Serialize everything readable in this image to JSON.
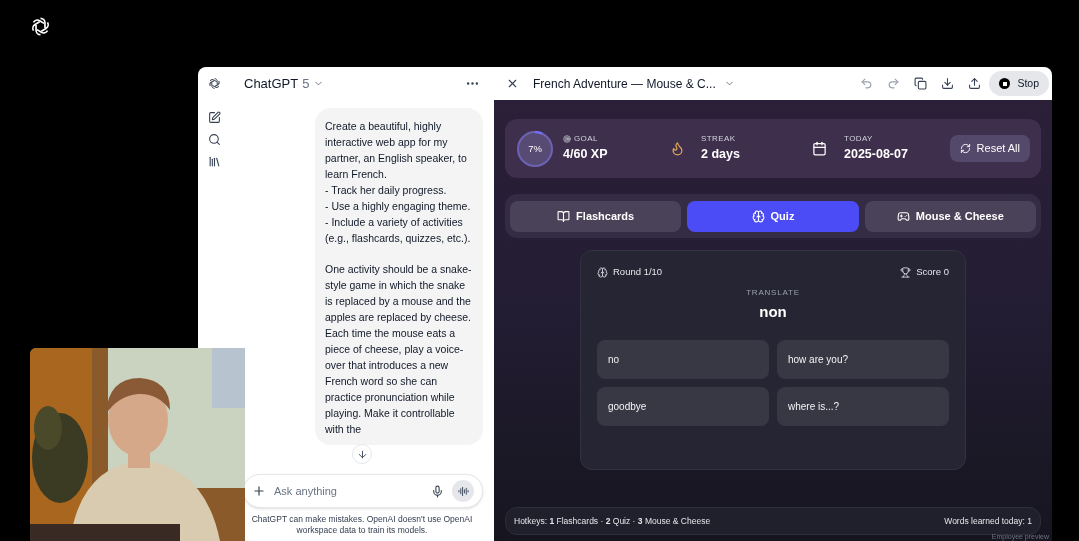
{
  "chat": {
    "title": "ChatGPT",
    "model": "5",
    "message": [
      {
        "lines": [
          "Create a beautiful, highly interactive web app for my partner, an English speaker, to learn French.",
          "- Track her daily progress.",
          "- Use a highly engaging theme.",
          "- Include a variety of activities (e.g., flashcards, quizzes, etc.)."
        ]
      },
      {
        "lines": [
          "One activity should be a snake-style game in which the snake is replaced by a mouse and the apples are replaced by cheese. Each time the mouse eats a piece of cheese, play a voice-over that introduces a new French word so she can practice pronunciation while playing. Make it controllable with the"
        ]
      }
    ],
    "input": {
      "placeholder": "Ask anything"
    },
    "disclaimer": "ChatGPT can make mistakes. OpenAI doesn't use OpenAI workspace data to train its models."
  },
  "canvas": {
    "title": "French Adventure — Mouse & C...",
    "stop_label": "Stop",
    "stats": {
      "progress_label": "7%",
      "level": 0.07,
      "goal_label": "GOAL",
      "goal_value": "4/60 XP",
      "streak_label": "STREAK",
      "streak_value": "2 days",
      "today_label": "TODAY",
      "today_value": "2025-08-07",
      "reset_label": "Reset All"
    },
    "tabs": [
      {
        "label": "Flashcards",
        "kind": "book",
        "selected": false
      },
      {
        "label": "Quiz",
        "kind": "brain",
        "selected": true
      },
      {
        "label": "Mouse & Cheese",
        "kind": "gamepad",
        "selected": false
      }
    ],
    "quiz": {
      "round": "Round 1/10",
      "score": "Score 0",
      "prompt_label": "TRANSLATE",
      "word": "non",
      "options": [
        "no",
        "how are you?",
        "goodbye",
        "where is...?"
      ]
    },
    "footer": {
      "hotkeys": "Hotkeys: **1** Flashcards · **2** Quiz · **3** Mouse & Cheese",
      "words_learned": "Words learned today: 1"
    },
    "badge": "Employee preview"
  }
}
